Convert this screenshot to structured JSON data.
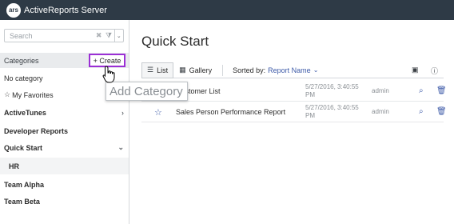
{
  "app": {
    "title": "ActiveReports Server",
    "logo_text": "ars"
  },
  "sidebar": {
    "search": {
      "placeholder": "Search",
      "value": ""
    },
    "categories_header": "Categories",
    "create_label": "+ Create",
    "items": [
      {
        "label": "No category"
      },
      {
        "label": "My Favorites"
      },
      {
        "label": "ActiveTunes"
      },
      {
        "label": "Developer Reports"
      },
      {
        "label": "Quick Start"
      },
      {
        "label": "HR"
      },
      {
        "label": "Team Alpha"
      },
      {
        "label": "Team Beta"
      }
    ]
  },
  "tooltip": {
    "text": "Add Category"
  },
  "main": {
    "title": "Quick Start",
    "views": [
      {
        "label": "List"
      },
      {
        "label": "Gallery"
      }
    ],
    "sorted_by_label": "Sorted by:",
    "sorted_by_value": "Report Name",
    "rows": [
      {
        "name": "Customer List",
        "date": "5/27/2016, 3:40:55 PM",
        "author": "admin"
      },
      {
        "name": "Sales Person Performance Report",
        "date": "5/27/2016, 3:40:55 PM",
        "author": "admin"
      }
    ]
  },
  "icons": {
    "star": "star-icon",
    "search": "search-icon",
    "delete": "trash-icon",
    "list": "list-icon",
    "gallery": "grid-icon",
    "info": "info-icon",
    "export": "document-icon"
  },
  "colors": {
    "topbar": "#2e3a46",
    "accent": "#3d5aa8",
    "highlight": "#9b2fd5"
  }
}
